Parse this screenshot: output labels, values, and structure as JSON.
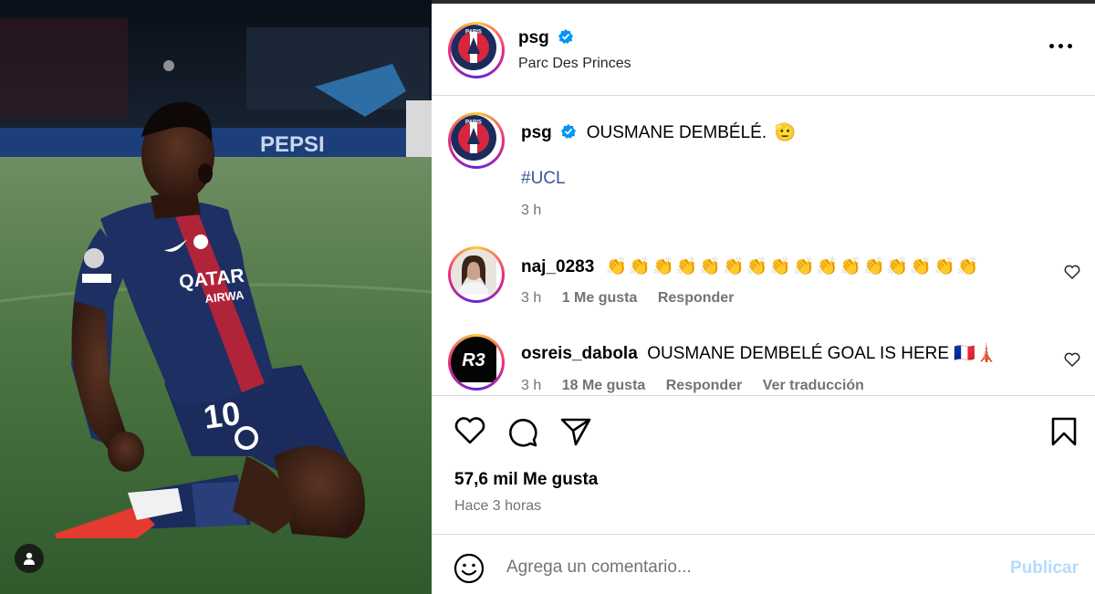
{
  "post": {
    "account": "psg",
    "location": "Parc Des Princes",
    "caption": {
      "username": "psg",
      "text": "OUSMANE DEMBÉLÉ.",
      "emoji": "🫡",
      "hashtag": "#UCL",
      "time": "3 h"
    },
    "image_banner_text": "PEPSI",
    "jersey_sponsor": "QATAR AIRWAYS",
    "jersey_number": "10"
  },
  "comments": [
    {
      "username": "naj_0283",
      "text": "👏👏👏👏👏👏👏👏👏👏👏👏👏👏👏👏",
      "time": "3 h",
      "likes": "1 Me gusta",
      "reply": "Responder"
    },
    {
      "username": "osreis_dabola",
      "avatar_text": "R3",
      "text": "OUSMANE DEMBELÉ GOAL IS HERE 🇫🇷🗼",
      "time": "3 h",
      "likes": "18 Me gusta",
      "reply": "Responder",
      "translate": "Ver traducción"
    }
  ],
  "engagement": {
    "likes": "57,6 mil Me gusta",
    "time": "Hace 3 horas"
  },
  "composer": {
    "placeholder": "Agrega un comentario...",
    "publish": "Publicar"
  },
  "colors": {
    "verified": "#0095f6",
    "link": "#385898",
    "publish_disabled": "#b3dbff",
    "psg_navy": "#1b2b5c",
    "psg_red": "#d7263d"
  }
}
